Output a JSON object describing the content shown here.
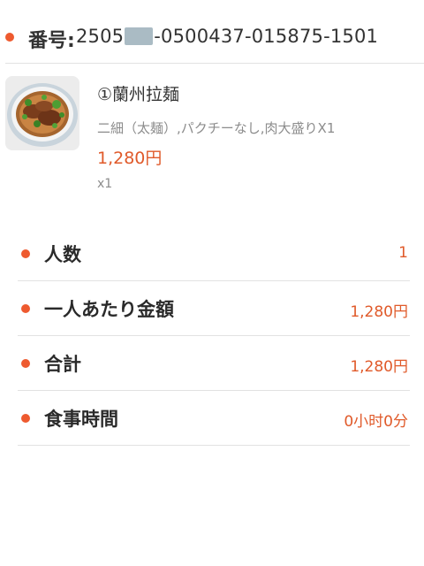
{
  "order": {
    "label": "番号:",
    "number_prefix": "2505",
    "number_suffix": "-0500437-015875-1501"
  },
  "item": {
    "name": "①蘭州拉麺",
    "options": "二細（太麺）,パクチーなし,肉大盛りX1",
    "price": "1,280円",
    "quantity": "x1"
  },
  "info": [
    {
      "label": "人数",
      "value": "1"
    },
    {
      "label": "一人あたり金額",
      "value": "1,280円"
    },
    {
      "label": "合計",
      "value": "1,280円"
    },
    {
      "label": "食事時間",
      "value": "0小时0分"
    }
  ],
  "colors": {
    "accent": "#ee5a2f",
    "price": "#e05a2a",
    "divider": "#e2e2e2"
  }
}
